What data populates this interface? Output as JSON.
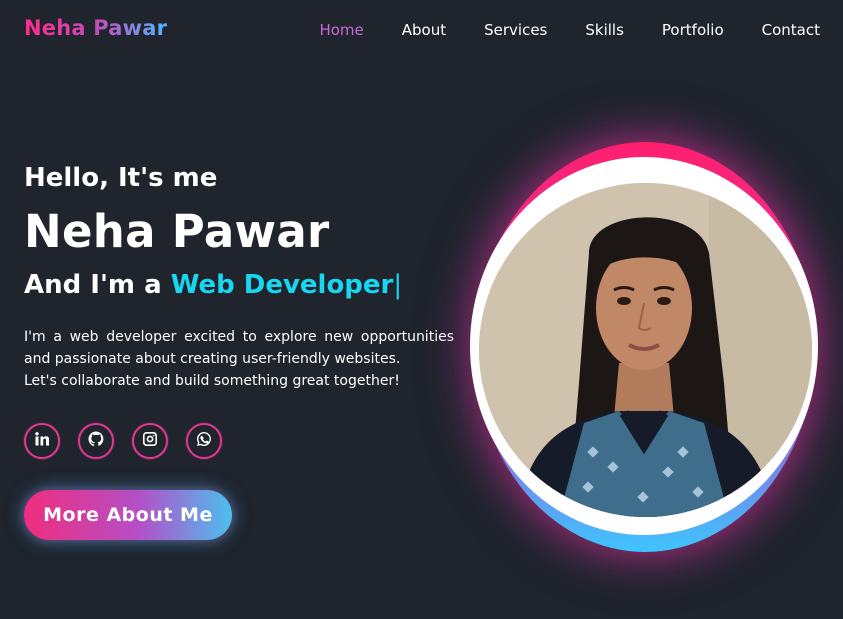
{
  "brand": {
    "logo": "Neha Pawar"
  },
  "nav": {
    "items": [
      {
        "label": "Home",
        "active": true
      },
      {
        "label": "About"
      },
      {
        "label": "Services"
      },
      {
        "label": "Skills"
      },
      {
        "label": "Portfolio"
      },
      {
        "label": "Contact"
      }
    ]
  },
  "hero": {
    "greeting": "Hello, It's me",
    "name": "Neha Pawar",
    "role_prefix": "And I'm a",
    "role_highlight": "Web Developer",
    "cursor": "|",
    "description_lines": [
      "I'm a web developer excited to explore new opportunities",
      "and passionate about creating user-friendly websites.",
      "Let's collaborate and build something great together!"
    ],
    "cta_label": "More About Me"
  },
  "socials": [
    {
      "icon": "linkedin-icon"
    },
    {
      "icon": "github-icon"
    },
    {
      "icon": "instagram-icon"
    },
    {
      "icon": "whatsapp-icon"
    }
  ],
  "colors": {
    "background": "#1f242d",
    "accent_cyan": "#18d6f0",
    "accent_pink": "#ff2d8a",
    "nav_active": "#c86ad6"
  }
}
